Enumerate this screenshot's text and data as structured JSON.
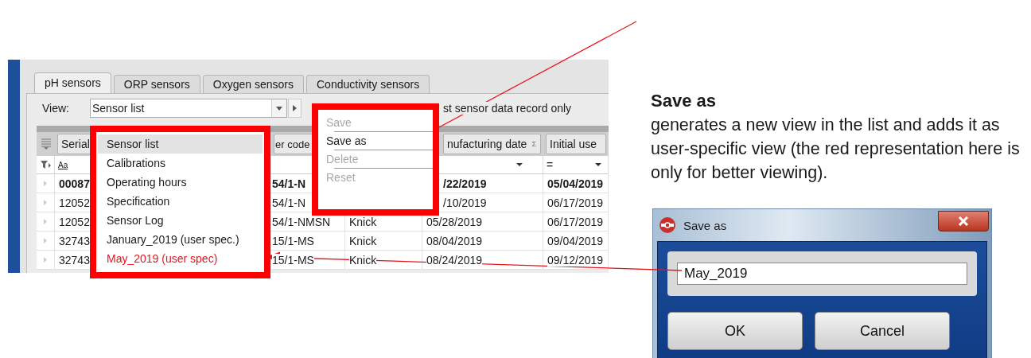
{
  "callout": {
    "title": "Save as",
    "text": "generates a new view in the list and adds it as user-specific view (the red representation here is only for better viewing)."
  },
  "app": {
    "tabs": [
      {
        "label": "pH sensors",
        "selected": true
      },
      {
        "label": "ORP sensors",
        "selected": false
      },
      {
        "label": "Oxygen sensors",
        "selected": false
      },
      {
        "label": "Conductivity sensors",
        "selected": false
      }
    ],
    "view_label": "View:",
    "view_value": "Sensor list",
    "option_text": "st sensor data record only",
    "columns": [
      {
        "label": "Serial"
      },
      {
        "label": "er code"
      },
      {
        "label": "nufacturing date",
        "mark": "Σ"
      },
      {
        "label": "Initial use"
      }
    ],
    "filter": {
      "serial_hint": "Aa",
      "initial_use_operator": "="
    },
    "rows": [
      {
        "bold": true,
        "serial": "00087",
        "order_code": "54/1-N",
        "date": "/22/2019",
        "initial_use": "05/04/2019"
      },
      {
        "bold": false,
        "serial": "12052",
        "order_code": "54/1-N",
        "date": "/10/2019",
        "initial_use": "06/17/2019"
      },
      {
        "bold": false,
        "serial": "12052",
        "order_code": "54/1-NMSN",
        "manufacturer": "Knick",
        "date": "05/28/2019",
        "initial_use": "06/17/2019"
      },
      {
        "bold": false,
        "serial": "32743",
        "order_code": "15/1-MS",
        "manufacturer": "Knick",
        "date": "08/04/2019",
        "initial_use": "09/04/2019"
      },
      {
        "bold": false,
        "serial": "32743",
        "order_code": "15/1-MS",
        "manufacturer": "Knick",
        "date": "08/24/2019",
        "initial_use": "09/12/2019"
      }
    ]
  },
  "view_menu": [
    {
      "label": "Sensor list",
      "selected": true,
      "color": "#1a1a1a"
    },
    {
      "label": "Calibrations",
      "selected": false,
      "color": "#1a1a1a"
    },
    {
      "label": "Operating hours",
      "selected": false,
      "color": "#1a1a1a"
    },
    {
      "label": "Specification",
      "selected": false,
      "color": "#1a1a1a"
    },
    {
      "label": "Sensor Log",
      "selected": false,
      "color": "#1a1a1a"
    },
    {
      "label": "January_2019 (user spec.)",
      "selected": false,
      "color": "#1a1a1a"
    },
    {
      "label": "May_2019 (user spec)",
      "selected": false,
      "color": "#e8141b"
    }
  ],
  "save_menu": [
    {
      "label": "Save",
      "disabled": true
    },
    {
      "label": "Save as",
      "disabled": false
    },
    {
      "label": "Delete",
      "disabled": true
    },
    {
      "label": "Reset",
      "disabled": true
    }
  ],
  "dialog": {
    "title": "Save as",
    "value": "May_2019",
    "buttons": [
      "OK",
      "Cancel"
    ]
  }
}
